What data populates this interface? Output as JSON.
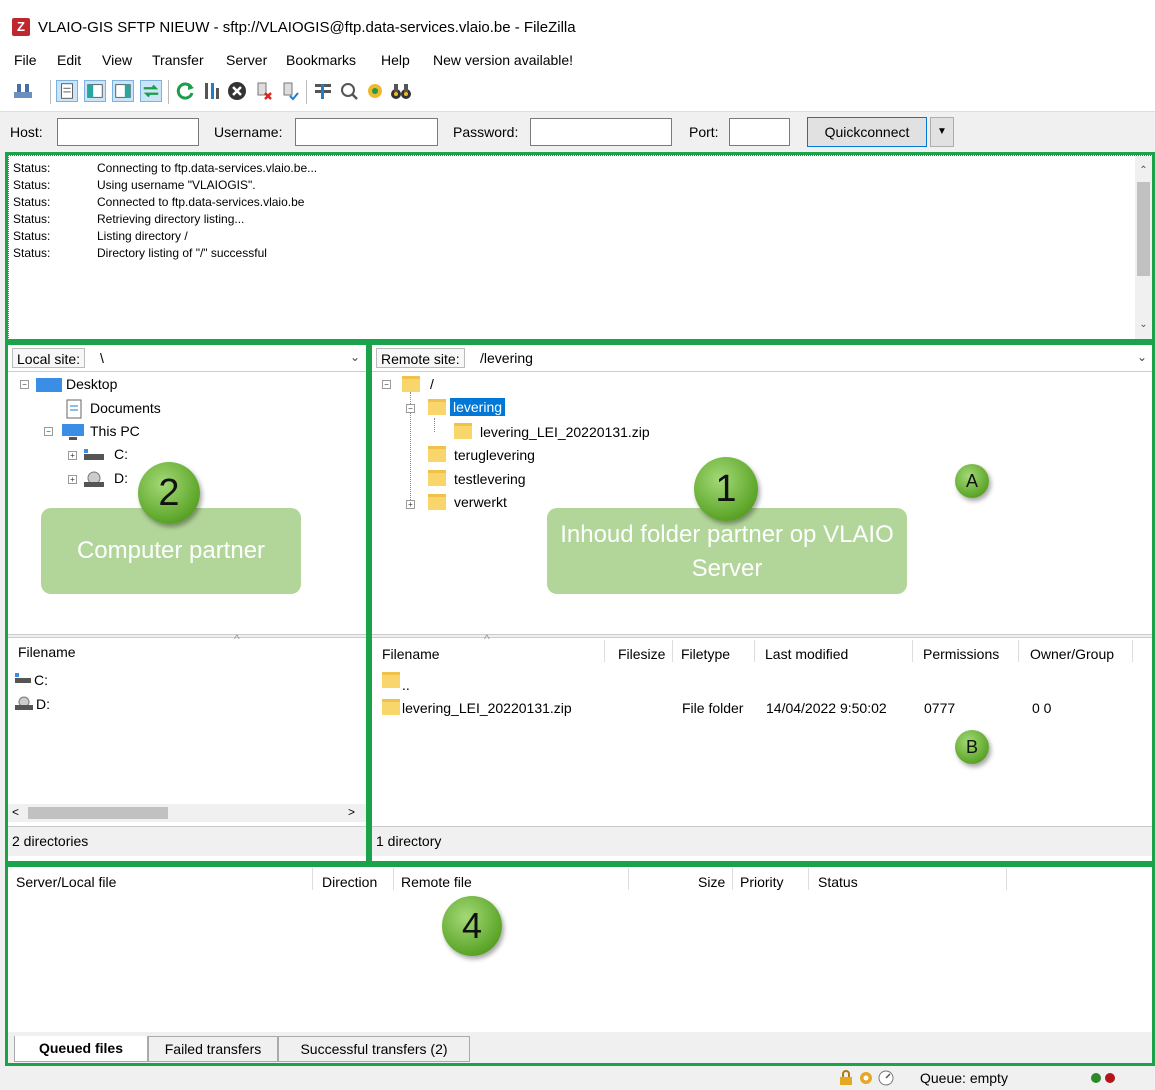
{
  "window": {
    "title": "VLAIO-GIS SFTP NIEUW - sftp://VLAIOGIS@ftp.data-services.vlaio.be - FileZilla",
    "app_icon": "Z"
  },
  "menu": [
    "File",
    "Edit",
    "View",
    "Transfer",
    "Server",
    "Bookmarks",
    "Help",
    "New version available!"
  ],
  "quickconnect": {
    "host_label": "Host:",
    "host_value": "",
    "username_label": "Username:",
    "username_value": "",
    "password_label": "Password:",
    "password_value": "",
    "port_label": "Port:",
    "port_value": "",
    "button": "Quickconnect"
  },
  "log": [
    {
      "k": "Status:",
      "v": "Connecting to ftp.data-services.vlaio.be..."
    },
    {
      "k": "Status:",
      "v": "Using username \"VLAIOGIS\"."
    },
    {
      "k": "Status:",
      "v": "Connected to ftp.data-services.vlaio.be"
    },
    {
      "k": "Status:",
      "v": "Retrieving directory listing..."
    },
    {
      "k": "Status:",
      "v": "Listing directory /"
    },
    {
      "k": "Status:",
      "v": "Directory listing of \"/\" successful"
    }
  ],
  "local": {
    "label": "Local site:",
    "path": "\\",
    "tree": [
      "Desktop",
      "Documents",
      "This PC",
      "C:",
      "D:"
    ],
    "file_header": "Filename",
    "files": [
      "C:",
      "D:"
    ],
    "status": "2 directories"
  },
  "remote": {
    "label": "Remote site:",
    "path": "/levering",
    "tree": [
      "/",
      "levering",
      "levering_LEI_20220131.zip",
      "teruglevering",
      "testlevering",
      "verwerkt"
    ],
    "headers": [
      "Filename",
      "Filesize",
      "Filetype",
      "Last modified",
      "Permissions",
      "Owner/Group"
    ],
    "files": [
      {
        "name": "..",
        "size": "",
        "type": "",
        "modified": "",
        "perm": "",
        "owner": ""
      },
      {
        "name": "levering_LEI_20220131.zip",
        "size": "",
        "type": "File folder",
        "modified": "14/04/2022 9:50:02",
        "perm": "0777",
        "owner": "0 0"
      }
    ],
    "status": "1 directory"
  },
  "queue": {
    "headers": [
      "Server/Local file",
      "Direction",
      "Remote file",
      "Size",
      "Priority",
      "Status"
    ],
    "tabs": [
      "Queued files",
      "Failed transfers",
      "Successful transfers (2)"
    ]
  },
  "annotations": {
    "n1": "1",
    "n2": "2",
    "n4": "4",
    "a": "A",
    "b": "B",
    "box1": "Inhoud folder partner op VLAIO Server",
    "box2": "Computer partner"
  },
  "bottom_status": "Queue: empty",
  "colors": {
    "frame": "#1aa34a",
    "selection": "#0078d7",
    "folder": "#f9d66c"
  }
}
